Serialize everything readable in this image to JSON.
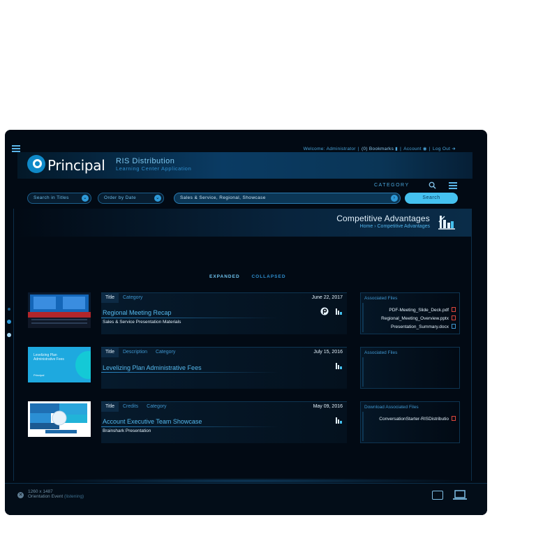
{
  "topbar": {
    "welcome": "Welcome: Administrator",
    "bookmarks": "(0) Bookmarks",
    "account": "Account",
    "logout": "Log Out"
  },
  "brand": {
    "logo_text": "Principal",
    "app_title": "RIS Distribution",
    "app_subtitle": "Learning Center Application"
  },
  "filters": {
    "category_label": "CATEGORY",
    "search_in": "Search in Titles",
    "order_by": "Order by Date",
    "selected_categories": "Sales & Service, Regional, Showcase",
    "search_button": "Search"
  },
  "page": {
    "title": "Competitive Advantages",
    "breadcrumb_home": "Home",
    "breadcrumb_current": "Competitive Advantages",
    "view_expanded": "EXPANDED",
    "view_collapsed": "COLLAPSED"
  },
  "entries": [
    {
      "tabs": [
        "Title",
        "Category"
      ],
      "date": "June 22, 2017",
      "title": "Regional Meeting Recap",
      "subtitle": "Sales & Service Presentation Materials",
      "files_header": "Associated Files",
      "files": [
        "PDF-Meeting_Slide_Deck.pdf",
        "Regional_Meeting_Overview.pptx",
        "Presentation_Summary.docx"
      ]
    },
    {
      "tabs": [
        "Title",
        "Description",
        "Category"
      ],
      "date": "July 15, 2016",
      "title": "Levelizing Plan Administrative Fees",
      "subtitle": "",
      "files_header": "Associated Files",
      "files": [],
      "thumb_text": "Levelizing Plan Administrative Fees"
    },
    {
      "tabs": [
        "Title",
        "Credits",
        "Category"
      ],
      "date": "May 09, 2016",
      "title": "Account Executive Team Showcase",
      "subtitle": "Brainshark Presentation",
      "files_header": "Download Associated Files",
      "files": [
        "ConversationStarter-RISDistributio"
      ]
    }
  ],
  "status": {
    "dimensions": "1260 x 1487",
    "orientation": "Orientation Event",
    "orientation_state": "(listening)"
  },
  "colors": {
    "background": "#020a14",
    "accent": "#45c1ef",
    "link": "#55b9ee",
    "pdf_icon": "#e0473c"
  }
}
